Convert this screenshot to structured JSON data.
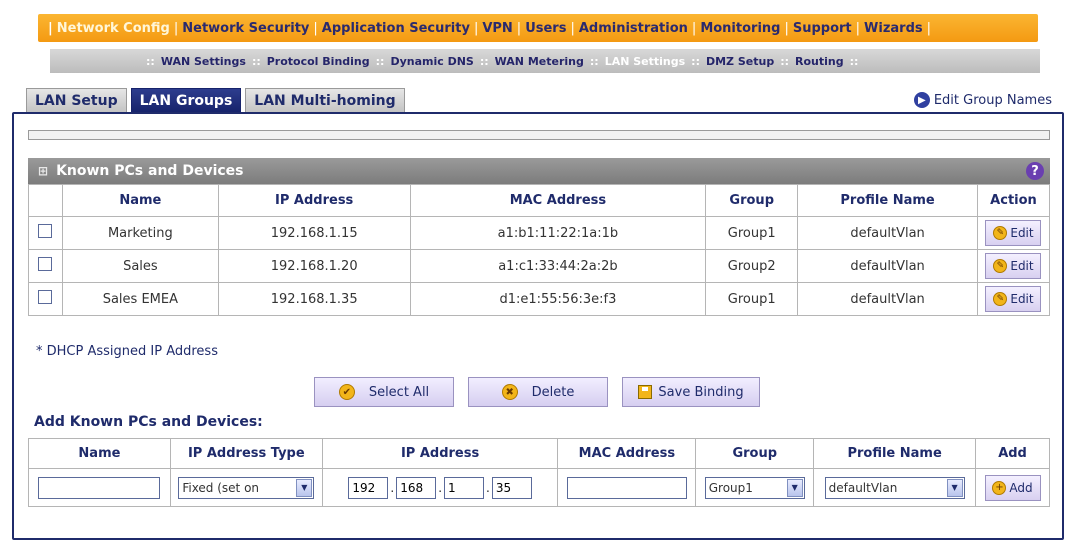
{
  "topnav": {
    "items": [
      {
        "label": "Network Config",
        "active": true
      },
      {
        "label": "Network Security"
      },
      {
        "label": "Application Security"
      },
      {
        "label": "VPN"
      },
      {
        "label": "Users"
      },
      {
        "label": "Administration"
      },
      {
        "label": "Monitoring"
      },
      {
        "label": "Support"
      },
      {
        "label": "Wizards"
      }
    ]
  },
  "subnav": {
    "items": [
      {
        "label": "WAN Settings"
      },
      {
        "label": "Protocol Binding"
      },
      {
        "label": "Dynamic DNS"
      },
      {
        "label": "WAN Metering"
      },
      {
        "label": "LAN Settings",
        "active": true
      },
      {
        "label": "DMZ Setup"
      },
      {
        "label": "Routing"
      }
    ]
  },
  "tabs": [
    {
      "label": "LAN Setup"
    },
    {
      "label": "LAN Groups",
      "active": true
    },
    {
      "label": "LAN Multi-homing"
    }
  ],
  "edit_group_names": "Edit Group Names",
  "known": {
    "title": "Known PCs and Devices",
    "help": "?",
    "columns": [
      "Name",
      "IP Address",
      "MAC Address",
      "Group",
      "Profile Name",
      "Action"
    ],
    "rows": [
      {
        "name": "Marketing",
        "ip": "192.168.1.15",
        "mac": "a1:b1:11:22:1a:1b",
        "group": "Group1",
        "profile": "defaultVlan",
        "action": "Edit"
      },
      {
        "name": "Sales",
        "ip": "192.168.1.20",
        "mac": "a1:c1:33:44:2a:2b",
        "group": "Group2",
        "profile": "defaultVlan",
        "action": "Edit"
      },
      {
        "name": "Sales EMEA",
        "ip": "192.168.1.35",
        "mac": "d1:e1:55:56:3e:f3",
        "group": "Group1",
        "profile": "defaultVlan",
        "action": "Edit"
      }
    ]
  },
  "dhcp_note": "* DHCP Assigned IP Address",
  "buttons": {
    "select_all": "Select All",
    "delete": "Delete",
    "save_binding": "Save Binding"
  },
  "add": {
    "title": "Add Known PCs and Devices:",
    "columns": [
      "Name",
      "IP Address Type",
      "IP Address",
      "MAC Address",
      "Group",
      "Profile Name",
      "Add"
    ],
    "name_value": "",
    "ip_type": "Fixed (set on",
    "ip_octets": [
      "192",
      "168",
      "1",
      "35"
    ],
    "mac_value": "",
    "group": "Group1",
    "profile": "defaultVlan",
    "add_label": "Add"
  },
  "colors": {
    "topnav": "#f49a12",
    "navy": "#1f2b6b",
    "header_gray": "#8a8a8a"
  }
}
